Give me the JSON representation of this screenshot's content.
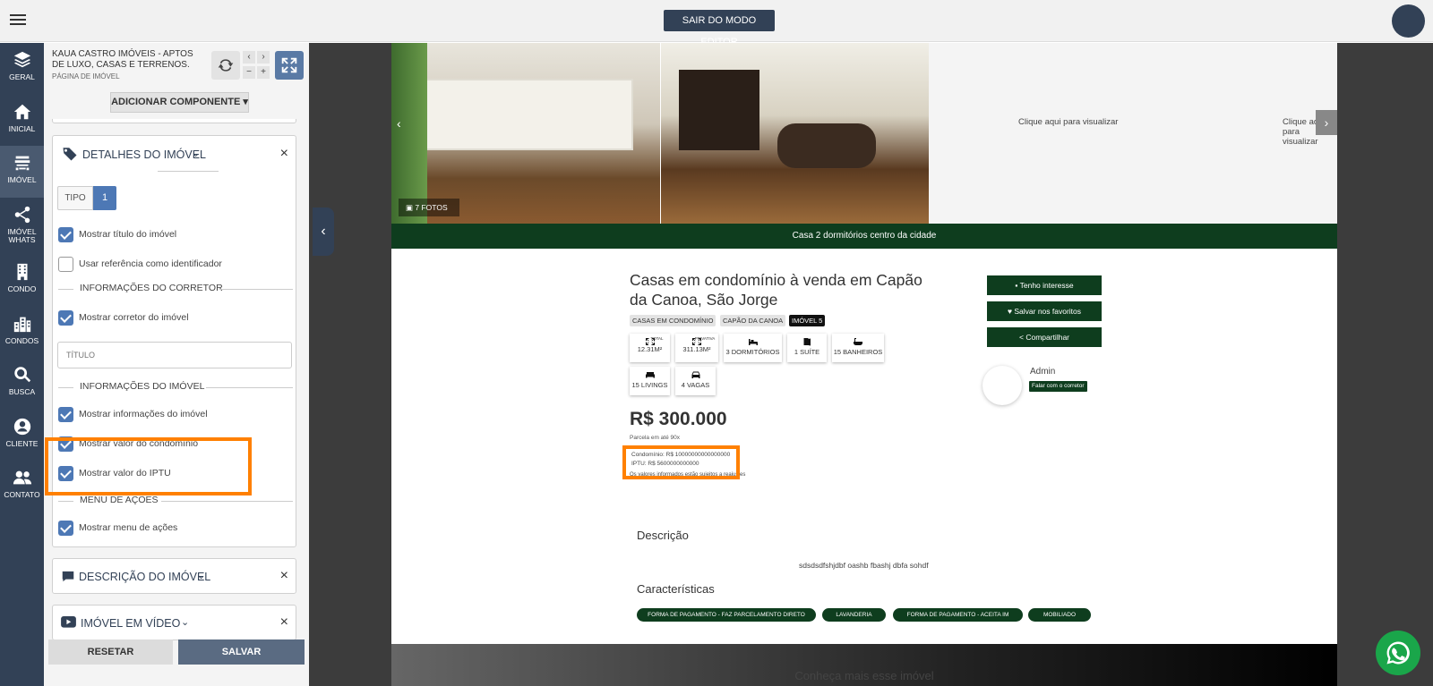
{
  "topbar": {
    "exit_label": "SAIR DO MODO EDITOR"
  },
  "nav": {
    "items": [
      {
        "label": "GERAL"
      },
      {
        "label": "INICIAL"
      },
      {
        "label": "IMÓVEL"
      },
      {
        "label": "IMÓVEL WHATS"
      },
      {
        "label": "CONDO"
      },
      {
        "label": "CONDOS"
      },
      {
        "label": "BUSCA"
      },
      {
        "label": "CLIENTE"
      },
      {
        "label": "CONTATO"
      }
    ]
  },
  "panel": {
    "site_title": "KAUA CASTRO IMÓVEIS - APTOS DE LUXO, CASAS E TERRENOS.",
    "page_subtitle": "PÁGINA DE IMÓVEL",
    "add_component": "ADICIONAR COMPONENTE",
    "details_card": {
      "title": "DETALHES DO IMÓVEL",
      "tipo_label": "TIPO",
      "tipo_value": "1",
      "show_title": "Mostrar título do imóvel",
      "use_ref": "Usar referência como identificador",
      "broker_section": "INFORMAÇÕES DO CORRETOR",
      "show_broker": "Mostrar corretor do imóvel",
      "title_placeholder": "TÍTULO",
      "property_section": "INFORMAÇÕES DO IMÓVEL",
      "show_property_info": "Mostrar informações do imóvel",
      "show_condo_value": "Mostrar valor do condomínio",
      "show_iptu_value": "Mostrar valor do IPTU",
      "actions_section": "MENU DE AÇÕES",
      "show_actions": "Mostrar menu de ações"
    },
    "description_card": {
      "title": "DESCRIÇÃO DO IMÓVEL"
    },
    "video_card": {
      "title": "IMÓVEL EM VÍDEO"
    },
    "reset_label": "RESETAR",
    "save_label": "SALVAR"
  },
  "preview": {
    "photo_count": "7 FOTOS",
    "photo_hint": "Clique aqui para visualizar",
    "banner": "Casa 2 dormitórios centro da cidade",
    "title": "Casas em condomínio à venda em Capão da Canoa, São Jorge",
    "tags": [
      "CASAS EM CONDOMÍNIO",
      "CAPÃO DA CANOA",
      "IMÓVEL 5"
    ],
    "features": [
      {
        "top": "TOTAL",
        "value": "12.31M²"
      },
      {
        "top": "PRIVATIVA",
        "value": "311.13M²"
      },
      {
        "top": "",
        "value": "3 DORMITÓRIOS"
      },
      {
        "top": "",
        "value": "1 SUÍTE"
      },
      {
        "top": "",
        "value": "15 BANHEIROS"
      },
      {
        "top": "",
        "value": "15 LIVINGS"
      },
      {
        "top": "",
        "value": "4 VAGAS"
      }
    ],
    "price": "R$ 300.000",
    "installments": "Parcela em até 90x",
    "condo_fee": "Condomínio: R$ 10000000000000000",
    "iptu_fee": "IPTU: R$ 5600000000000",
    "disclaimer": "Os valores informados estão sujeitos a reajustes",
    "actions": [
      "Tenho interesse",
      "Salvar nos favoritos",
      "Compartilhar"
    ],
    "agent_name": "Admin",
    "agent_chat": "Falar com o corretor",
    "description_title": "Descrição",
    "description_text": "sdsdsdfshjdbf oashb fbashj dbfa sohdf",
    "characteristics_title": "Características",
    "chips": [
      "FORMA DE PAGAMENTO - FAZ PARCELAMENTO DIRETO",
      "LAVANDERIA",
      "FORMA DE PAGAMENTO - ACEITA IM",
      "MOBILIADO"
    ],
    "footer_text": "Conheça mais esse imóvel"
  },
  "colors": {
    "nav_bg": "#324156",
    "accent": "#4d78b5",
    "brand_green": "#0e3d1e",
    "highlight": "#ff8000",
    "whatsapp": "#1aa64a"
  }
}
